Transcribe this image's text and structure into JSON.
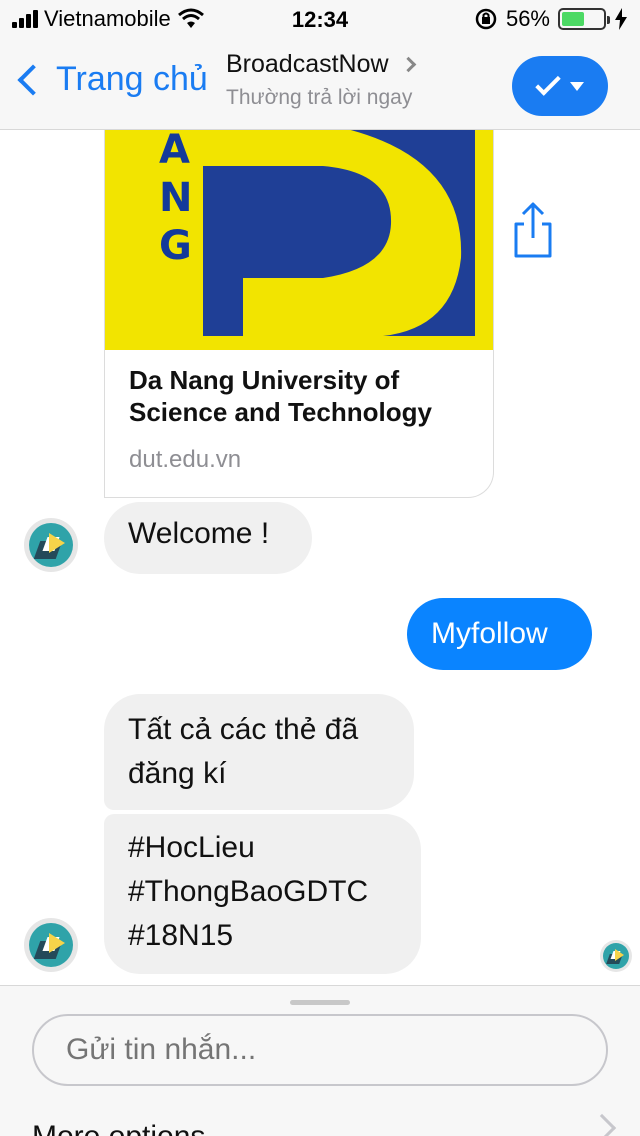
{
  "status_bar": {
    "carrier": "Vietnamobile",
    "time": "12:34",
    "battery_percent": "56%",
    "battery_level": 0.56
  },
  "nav": {
    "back_label": "Trang chủ",
    "title": "BroadcastNow",
    "subtitle": "Thường trả lời ngay",
    "action_icon": "check-icon",
    "accent_color": "#1a7cf2"
  },
  "link_card": {
    "logo_letters": [
      "A",
      "N",
      "G"
    ],
    "title_line1": "Da Nang University of",
    "title_line2": "Science and Technology",
    "url": "dut.edu.vn"
  },
  "messages": {
    "welcome": "Welcome !",
    "outgoing": "Myfollow",
    "tags_intro_line1": "Tất cả các thẻ đã",
    "tags_intro_line2": "đăng kí",
    "tag1": "#HocLieu",
    "tag2": "#ThongBaoGDTC",
    "tag3": "#18N15"
  },
  "composer": {
    "placeholder": "Gửi tin nhắn...",
    "more_options": "More options"
  }
}
